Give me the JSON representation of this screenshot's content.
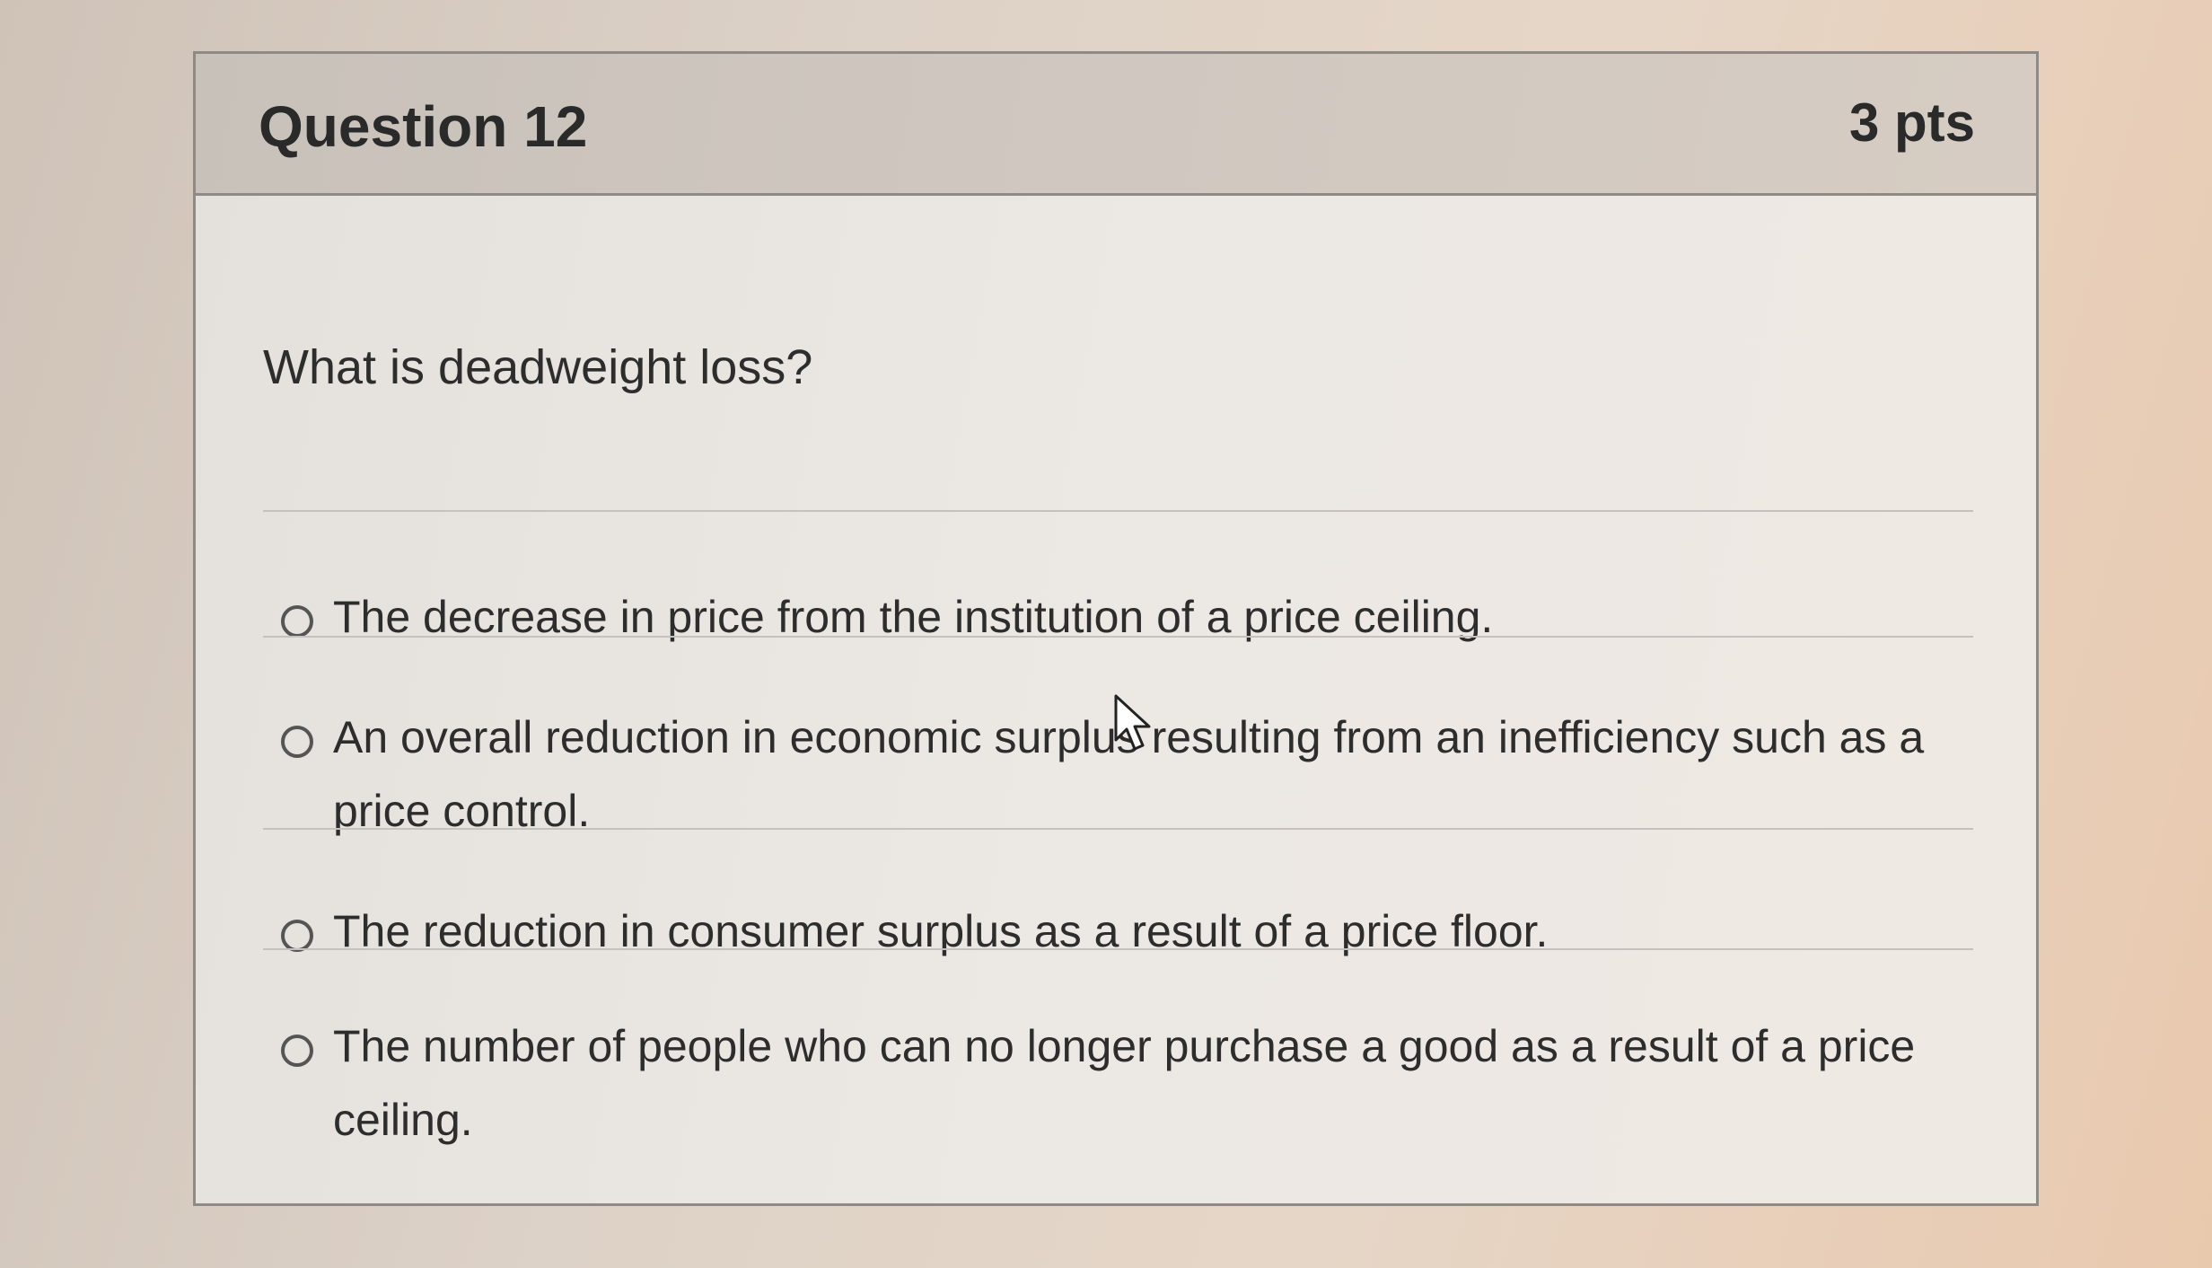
{
  "question": {
    "title": "Question 12",
    "points": "3 pts",
    "prompt": "What is deadweight loss?"
  },
  "answers": [
    {
      "label": "The decrease in price from the institution of a price ceiling.",
      "selected": false
    },
    {
      "label": "An overall reduction in economic surplus resulting from an inefficiency such as a price control.",
      "selected": false
    },
    {
      "label": "The reduction in consumer surplus as a result of a price floor.",
      "selected": false
    },
    {
      "label": "The number of people who can no longer purchase a good as a result of a price ceiling.",
      "selected": false
    }
  ],
  "icons": {
    "radio": "radio-unchecked-icon",
    "cursor": "mouse-pointer-icon"
  }
}
